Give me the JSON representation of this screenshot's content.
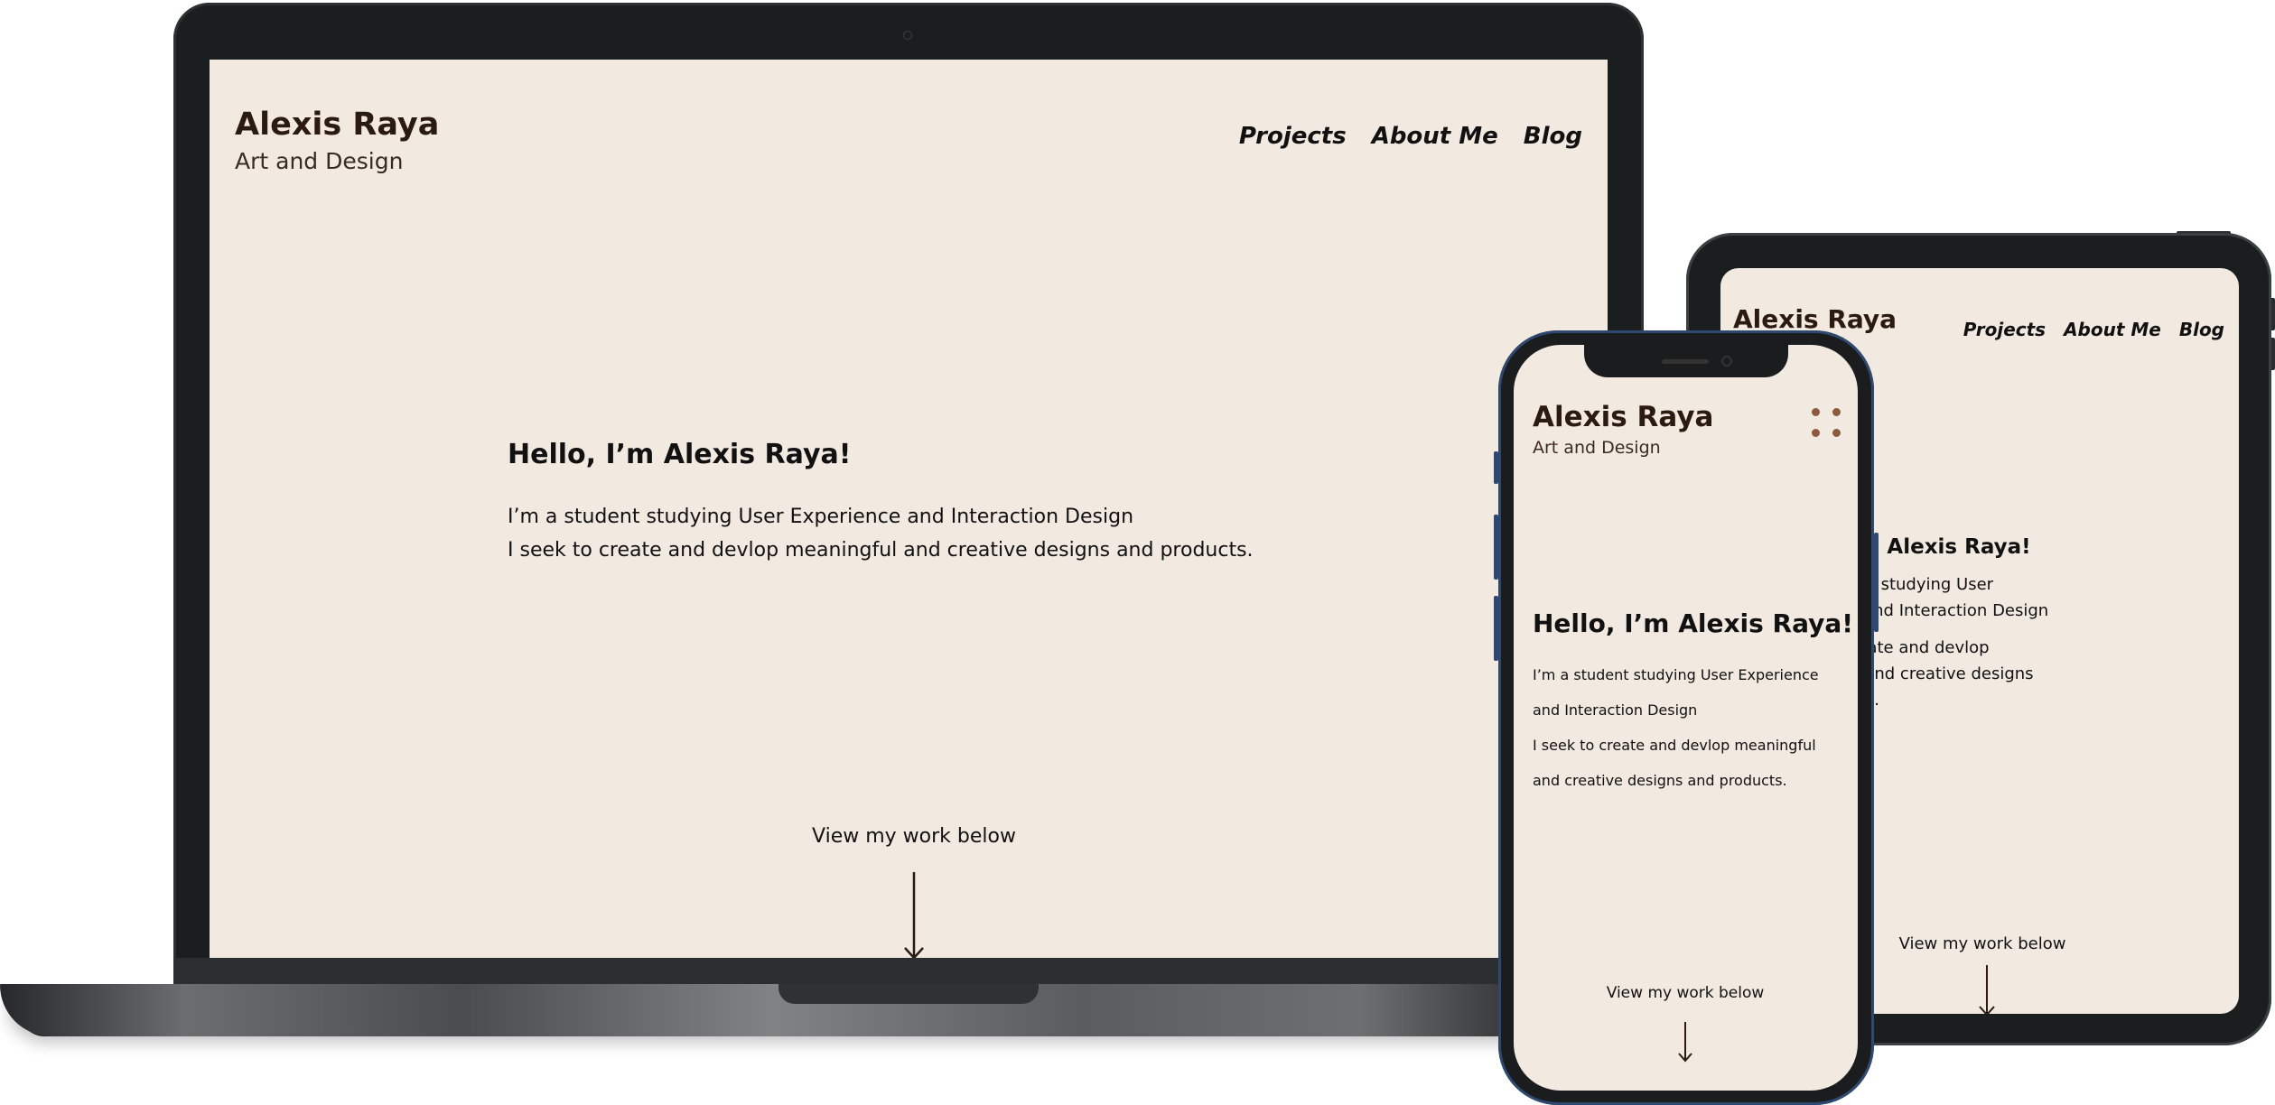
{
  "site": {
    "name": "Alexis Raya",
    "subtitle": "Art and Design"
  },
  "nav": {
    "items": [
      {
        "label": "Projects"
      },
      {
        "label": "About Me"
      },
      {
        "label": "Blog"
      }
    ]
  },
  "hero": {
    "heading": "Hello, I’m Alexis Raya!",
    "line1": "I’m a student studying User Experience and Interaction Design",
    "line2": "I seek to create and devlop meaningful and creative designs and products.",
    "cta": "View my work below"
  },
  "tablet": {
    "p1": "I’m a student studying User Experience and Interaction Design",
    "p2": "I seek to create and devlop meaningful and creative designs and products."
  },
  "phone": {
    "p1": "I’m a student studying User Experience and Interaction Design",
    "p2": "I seek to create and devlop meaningful and creative designs and products.",
    "menu_icon": "four-dot-menu-icon",
    "menu_color": "#8c5a3f"
  },
  "colors": {
    "page_background": "#f2e9e1",
    "device_frame": "#1b1e1f",
    "heading_text": "#2b1a10"
  }
}
